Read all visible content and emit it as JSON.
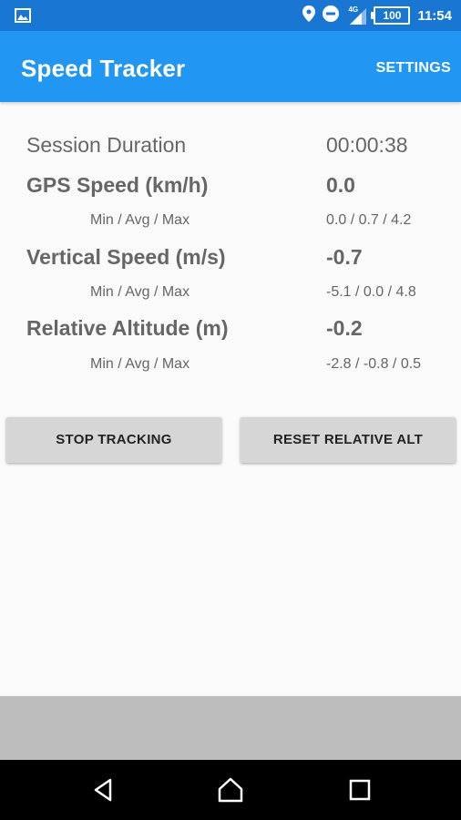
{
  "status_bar": {
    "time": "11:54",
    "battery": "100",
    "network_type": "4G",
    "icons": [
      "gallery-icon",
      "location-icon",
      "do-not-disturb-icon",
      "signal-icon",
      "battery-icon"
    ]
  },
  "app_bar": {
    "title": "Speed Tracker",
    "settings_label": "SETTINGS"
  },
  "metrics": {
    "session_duration": {
      "label": "Session Duration",
      "value": "00:00:38"
    },
    "gps_speed": {
      "label": "GPS Speed (km/h)",
      "value": "0.0",
      "sub_label": "Min / Avg / Max",
      "sub_value": "0.0 / 0.7 / 4.2"
    },
    "vertical_speed": {
      "label": "Vertical Speed (m/s)",
      "value": "-0.7",
      "sub_label": "Min / Avg / Max",
      "sub_value": "-5.1 / 0.0 / 4.8"
    },
    "relative_altitude": {
      "label": "Relative Altitude (m)",
      "value": "-0.2",
      "sub_label": "Min / Avg / Max",
      "sub_value": "-2.8 / -0.8 / 0.5"
    }
  },
  "buttons": {
    "stop_tracking": "STOP TRACKING",
    "reset_relative_alt": "RESET RELATIVE ALT"
  },
  "nav_bar": {
    "icons": [
      "back-icon",
      "home-icon",
      "recents-icon"
    ]
  },
  "colors": {
    "status_bar": "#1976d2",
    "app_bar": "#2196f3",
    "background": "#fafafa",
    "button": "#d6d6d6",
    "bottom_area": "#bdbdbd",
    "nav_bar": "#000000"
  }
}
